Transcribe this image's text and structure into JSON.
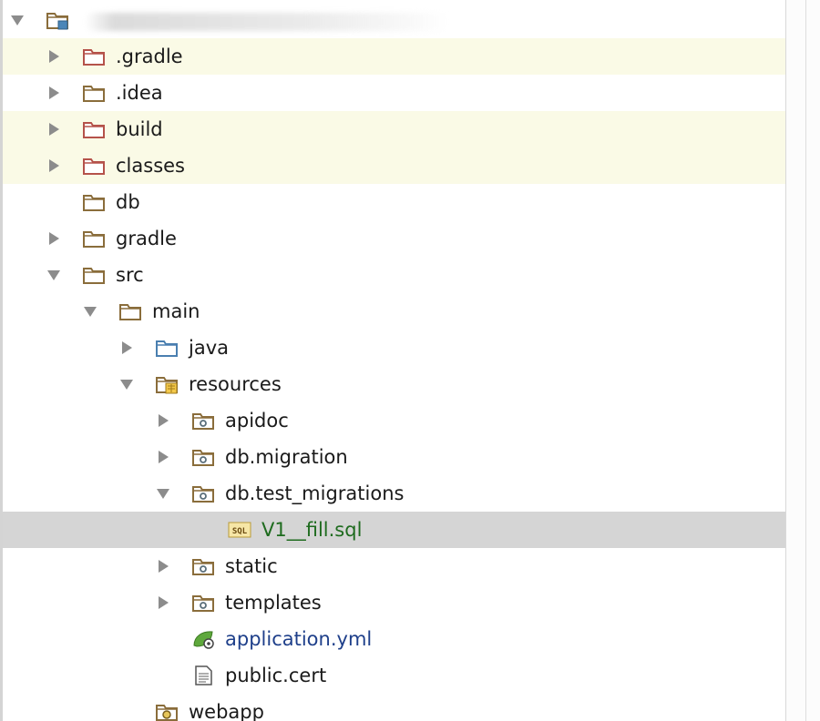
{
  "tree": {
    "rows": [
      {
        "label": "",
        "indent": 0,
        "arrow": "down",
        "icon": "module",
        "style": "",
        "label_color": "",
        "blurred": true
      },
      {
        "label": ".gradle",
        "indent": 1,
        "arrow": "right",
        "icon": "folder-excluded",
        "style": "hl",
        "label_color": ""
      },
      {
        "label": ".idea",
        "indent": 1,
        "arrow": "right",
        "icon": "folder",
        "style": "",
        "label_color": ""
      },
      {
        "label": "build",
        "indent": 1,
        "arrow": "right",
        "icon": "folder-excluded",
        "style": "hl",
        "label_color": ""
      },
      {
        "label": "classes",
        "indent": 1,
        "arrow": "right",
        "icon": "folder-excluded",
        "style": "hl",
        "label_color": ""
      },
      {
        "label": "db",
        "indent": 1,
        "arrow": "none",
        "icon": "folder",
        "style": "",
        "label_color": ""
      },
      {
        "label": "gradle",
        "indent": 1,
        "arrow": "right",
        "icon": "folder",
        "style": "",
        "label_color": ""
      },
      {
        "label": "src",
        "indent": 1,
        "arrow": "down",
        "icon": "folder",
        "style": "",
        "label_color": ""
      },
      {
        "label": "main",
        "indent": 2,
        "arrow": "down",
        "icon": "folder",
        "style": "",
        "label_color": ""
      },
      {
        "label": "java",
        "indent": 3,
        "arrow": "right",
        "icon": "folder-source",
        "style": "",
        "label_color": ""
      },
      {
        "label": "resources",
        "indent": 3,
        "arrow": "down",
        "icon": "folder-resources",
        "style": "",
        "label_color": ""
      },
      {
        "label": "apidoc",
        "indent": 4,
        "arrow": "right",
        "icon": "folder-package",
        "style": "",
        "label_color": ""
      },
      {
        "label": "db.migration",
        "indent": 4,
        "arrow": "right",
        "icon": "folder-package",
        "style": "",
        "label_color": ""
      },
      {
        "label": "db.test_migrations",
        "indent": 4,
        "arrow": "down",
        "icon": "folder-package",
        "style": "",
        "label_color": ""
      },
      {
        "label": "V1__fill.sql",
        "indent": 5,
        "arrow": "none",
        "icon": "sql-file",
        "style": "sel",
        "label_color": "green"
      },
      {
        "label": "static",
        "indent": 4,
        "arrow": "right",
        "icon": "folder-package",
        "style": "",
        "label_color": ""
      },
      {
        "label": "templates",
        "indent": 4,
        "arrow": "right",
        "icon": "folder-package",
        "style": "",
        "label_color": ""
      },
      {
        "label": "application.yml",
        "indent": 4,
        "arrow": "none",
        "icon": "spring-config-file",
        "style": "",
        "label_color": "blue"
      },
      {
        "label": "public.cert",
        "indent": 4,
        "arrow": "none",
        "icon": "text-file",
        "style": "",
        "label_color": ""
      },
      {
        "label": "webapp",
        "indent": 3,
        "arrow": "none",
        "icon": "folder-web",
        "style": "",
        "label_color": ""
      }
    ]
  },
  "colors": {
    "excluded_folder": "#b5524a",
    "folder": "#8a6d3b",
    "source_folder": "#4a7fb0",
    "highlight_row": "#fafae6",
    "selected_row": "#d5d5d5",
    "arrow": "#8c8c8c"
  }
}
